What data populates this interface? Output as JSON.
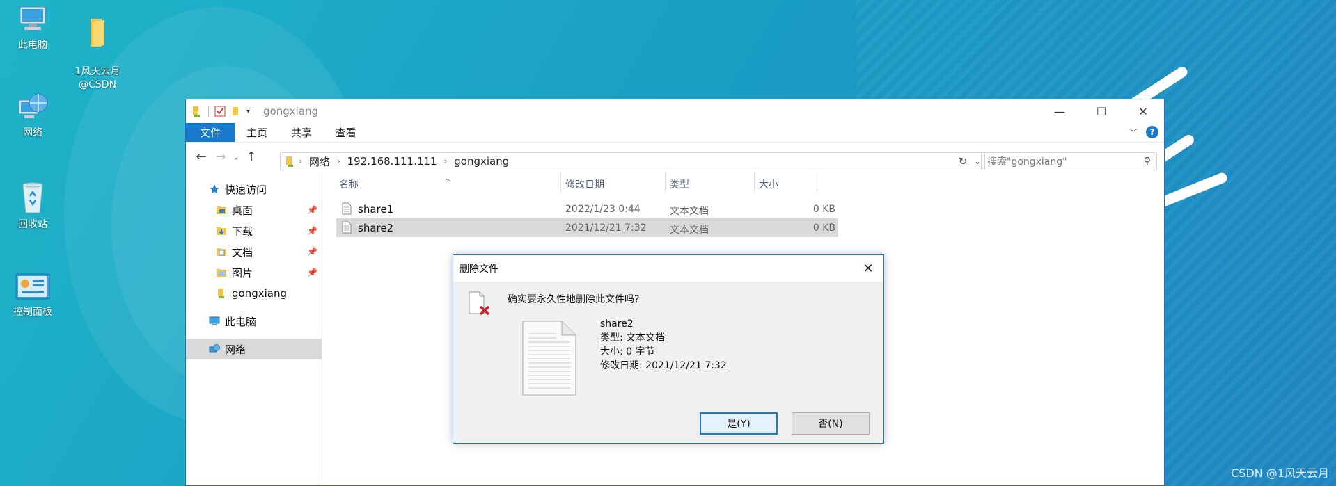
{
  "desktop": {
    "icons": [
      {
        "label": "此电脑"
      },
      {
        "label": "1风天云月\n@CSDN"
      },
      {
        "label": "网络"
      },
      {
        "label": "回收站"
      },
      {
        "label": "控制面板"
      }
    ],
    "watermark": "CSDN @1风天云月"
  },
  "window": {
    "title": "gongxiang",
    "controls": {
      "minimize": "—",
      "maximize": "☐",
      "close": "✕"
    },
    "ribbon": {
      "tabs": [
        {
          "label": "文件",
          "active": true
        },
        {
          "label": "主页"
        },
        {
          "label": "共享"
        },
        {
          "label": "查看"
        }
      ]
    },
    "address": {
      "crumbs": [
        "网络",
        "192.168.111.111",
        "gongxiang"
      ]
    },
    "search": {
      "placeholder": "搜索\"gongxiang\""
    },
    "sidebar": {
      "items": [
        {
          "label": "快速访问",
          "icon": "star-icon"
        },
        {
          "label": "桌面",
          "icon": "desktop-folder-icon",
          "pinned": true
        },
        {
          "label": "下载",
          "icon": "download-folder-icon",
          "pinned": true
        },
        {
          "label": "文档",
          "icon": "documents-folder-icon",
          "pinned": true
        },
        {
          "label": "图片",
          "icon": "pictures-folder-icon",
          "pinned": true
        },
        {
          "label": "gongxiang",
          "icon": "network-folder-icon"
        },
        {
          "label": "此电脑",
          "icon": "computer-icon"
        },
        {
          "label": "网络",
          "icon": "network-icon",
          "selected": true
        }
      ]
    },
    "columns": {
      "name": "名称",
      "date": "修改日期",
      "type": "类型",
      "size": "大小"
    },
    "files": [
      {
        "name": "share1",
        "date": "2022/1/23 0:44",
        "type": "文本文档",
        "size": "0 KB"
      },
      {
        "name": "share2",
        "date": "2021/12/21 7:32",
        "type": "文本文档",
        "size": "0 KB",
        "selected": true
      }
    ]
  },
  "dialog": {
    "title": "删除文件",
    "question": "确实要永久性地删除此文件吗?",
    "file": {
      "name": "share2",
      "type": "类型: 文本文档",
      "size": "大小: 0 字节",
      "date": "修改日期: 2021/12/21 7:32"
    },
    "yes_label": "是(Y)",
    "no_label": "否(N)"
  },
  "colors": {
    "accent": "#1979ca",
    "selection": "#d9d9d9",
    "desktop": "#1a9fc4"
  }
}
